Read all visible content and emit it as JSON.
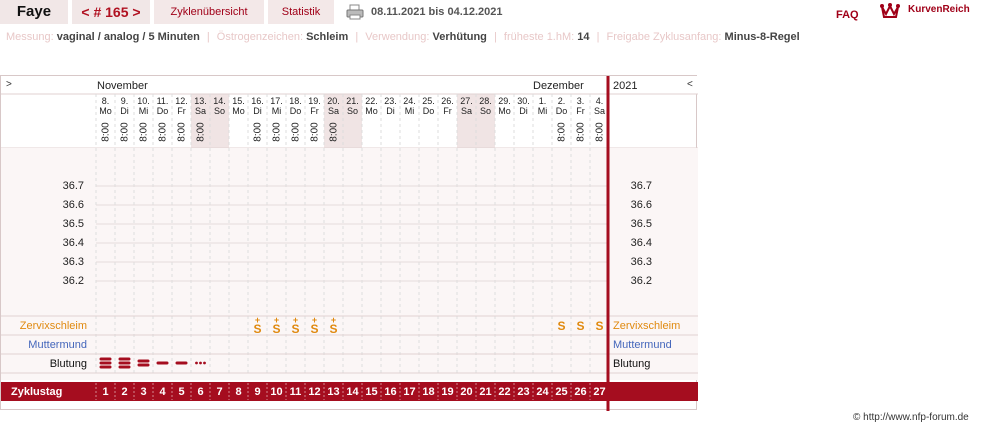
{
  "header": {
    "name": "Faye",
    "cycle_prev": "<",
    "cycle_label": "# 165",
    "cycle_next": ">",
    "overview_tab": "Zyklenübersicht",
    "stats_tab": "Statistik",
    "date_range": "08.11.2021 bis 04.12.2021",
    "faq": "FAQ",
    "brand": "KurvenReich"
  },
  "meta": [
    {
      "key": "Messung:",
      "value": "vaginal / analog / 5 Minuten"
    },
    {
      "key": "Östrogenzeichen:",
      "value": "Schleim"
    },
    {
      "key": "Verwendung:",
      "value": "Verhütung"
    },
    {
      "key": "früheste 1.hM:",
      "value": "14"
    },
    {
      "key": "Freigabe Zyklusanfang:",
      "value": "Minus-8-Regel"
    }
  ],
  "chart": {
    "nav_left": ">",
    "nav_right": "<",
    "month_1": "November",
    "month_2": "Dezember",
    "year": "2021",
    "time": "8:00",
    "days": [
      {
        "d": "8.",
        "wd": "Mo"
      },
      {
        "d": "9.",
        "wd": "Di"
      },
      {
        "d": "10.",
        "wd": "Mi"
      },
      {
        "d": "11.",
        "wd": "Do"
      },
      {
        "d": "12.",
        "wd": "Fr"
      },
      {
        "d": "13.",
        "wd": "Sa"
      },
      {
        "d": "14.",
        "wd": "So"
      },
      {
        "d": "15.",
        "wd": "Mo"
      },
      {
        "d": "16.",
        "wd": "Di"
      },
      {
        "d": "17.",
        "wd": "Mi"
      },
      {
        "d": "18.",
        "wd": "Do"
      },
      {
        "d": "19.",
        "wd": "Fr"
      },
      {
        "d": "20.",
        "wd": "Sa"
      },
      {
        "d": "21.",
        "wd": "So"
      },
      {
        "d": "22.",
        "wd": "Mo"
      },
      {
        "d": "23.",
        "wd": "Di"
      },
      {
        "d": "24.",
        "wd": "Mi"
      },
      {
        "d": "25.",
        "wd": "Do"
      },
      {
        "d": "26.",
        "wd": "Fr"
      },
      {
        "d": "27.",
        "wd": "Sa"
      },
      {
        "d": "28.",
        "wd": "So"
      },
      {
        "d": "29.",
        "wd": "Mo"
      },
      {
        "d": "30.",
        "wd": "Di"
      },
      {
        "d": "1.",
        "wd": "Mi"
      },
      {
        "d": "2.",
        "wd": "Do"
      },
      {
        "d": "3.",
        "wd": "Fr"
      },
      {
        "d": "4.",
        "wd": "Sa"
      }
    ],
    "measured_days": [
      0,
      1,
      2,
      3,
      4,
      5,
      8,
      9,
      10,
      11,
      12,
      24,
      25,
      26
    ],
    "weekend_days": [
      5,
      6,
      12,
      13,
      19,
      20
    ],
    "temp_labels": [
      "36.7",
      "36.6",
      "36.5",
      "36.4",
      "36.3",
      "36.2"
    ],
    "cervix_label": "Zervixschleim",
    "cervix_marks": [
      {
        "day": 8,
        "sym": "S",
        "plus": "+"
      },
      {
        "day": 9,
        "sym": "S",
        "plus": "+"
      },
      {
        "day": 10,
        "sym": "S",
        "plus": "+"
      },
      {
        "day": 11,
        "sym": "S",
        "plus": "+"
      },
      {
        "day": 12,
        "sym": "S",
        "plus": "+"
      },
      {
        "day": 24,
        "sym": "S",
        "plus": ""
      },
      {
        "day": 25,
        "sym": "S",
        "plus": ""
      },
      {
        "day": 26,
        "sym": "S",
        "plus": ""
      }
    ],
    "cervix_color": "#e08a10",
    "muttermund_label": "Muttermund",
    "muttermund_color": "#4466bb",
    "bleeding_label": "Blutung",
    "bleeding": [
      {
        "day": 0,
        "level": "heavy"
      },
      {
        "day": 1,
        "level": "heavy"
      },
      {
        "day": 2,
        "level": "medium"
      },
      {
        "day": 3,
        "level": "light"
      },
      {
        "day": 4,
        "level": "light"
      },
      {
        "day": 5,
        "level": "spotting"
      }
    ],
    "cycle_day_label": "Zyklustag",
    "cycle_days": [
      "1",
      "2",
      "3",
      "4",
      "5",
      "6",
      "7",
      "8",
      "9",
      "10",
      "11",
      "12",
      "13",
      "14",
      "15",
      "16",
      "17",
      "18",
      "19",
      "20",
      "21",
      "22",
      "23",
      "24",
      "25",
      "26",
      "27"
    ],
    "accent": "#a50d1f",
    "weekend_bg": "#f0e4e4"
  },
  "footer": "© http://www.nfp-forum.de"
}
